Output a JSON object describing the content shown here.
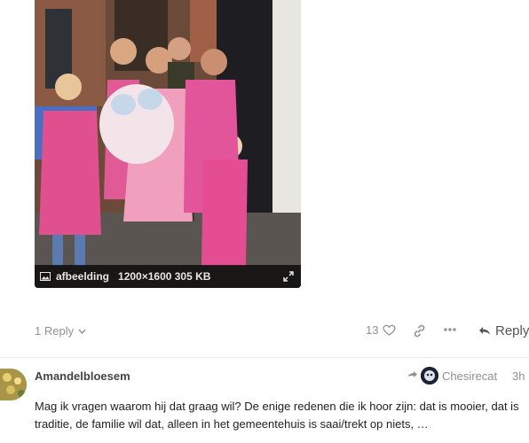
{
  "image": {
    "filename": "afbeelding",
    "dimensions": "1200×1600 305 KB"
  },
  "controls": {
    "replies_label": "1 Reply",
    "like_count": "13",
    "reply_label": "Reply"
  },
  "next_post": {
    "author": "Amandelbloesem",
    "reply_to_user": "Chesirecat",
    "time": "3h",
    "body": "Mag ik vragen waarom hij dat graag wil? De enige redenen die ik hoor zijn: dat is mooier, dat is traditie, de familie wil dat, alleen in het gemeentehuis is saai/trekt op niets, …"
  },
  "colors": {
    "apron": "#e0508f",
    "meta_bar": "#000000",
    "muted_text": "#919191"
  }
}
